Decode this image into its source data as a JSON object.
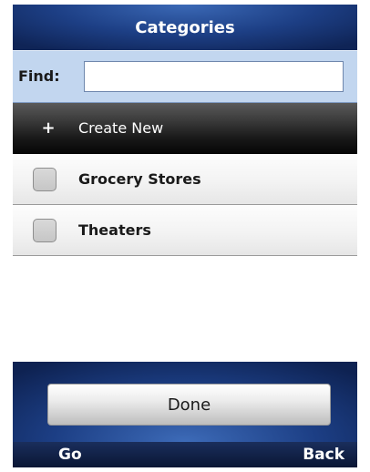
{
  "header": {
    "title": "Categories"
  },
  "find": {
    "label": "Find:",
    "value": "",
    "placeholder": ""
  },
  "create_new": {
    "label": "Create New",
    "icon": "plus-icon"
  },
  "categories": [
    {
      "label": "Grocery Stores",
      "checked": false
    },
    {
      "label": "Theaters",
      "checked": false
    }
  ],
  "actions": {
    "done_label": "Done"
  },
  "softkeys": {
    "left_label": "Go",
    "right_label": "Back"
  }
}
